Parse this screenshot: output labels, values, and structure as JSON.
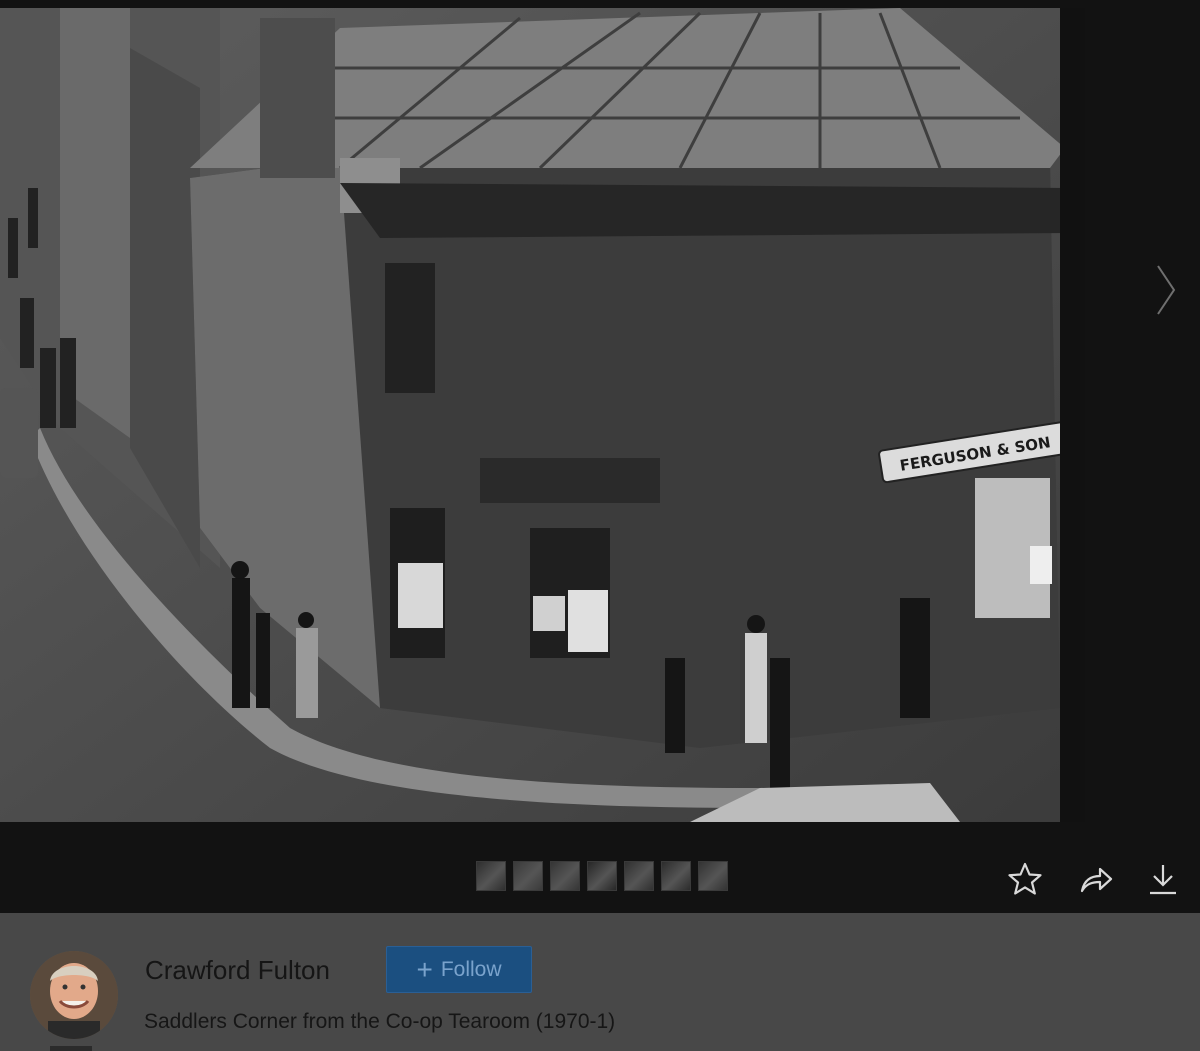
{
  "photo": {
    "shop_sign": "FERGUSON & SON"
  },
  "author": {
    "name": "Crawford Fulton"
  },
  "follow": {
    "label": "Follow"
  },
  "caption": "Saddlers Corner from the Co-op Tearoom (1970-1)",
  "thumbnails": [
    {
      "tone": "#2e2e2e"
    },
    {
      "tone": "#3a3a3a"
    },
    {
      "tone": "#353535"
    },
    {
      "tone": "#272727"
    },
    {
      "tone": "#303030"
    },
    {
      "tone": "#2c2c2c"
    },
    {
      "tone": "#333333"
    }
  ],
  "icons": {
    "next": "chevron-right-icon",
    "favorite": "star-icon",
    "share": "share-arrow-icon",
    "download": "download-icon"
  },
  "colors": {
    "follow_bg": "#1b4f80",
    "info_bg": "#484848",
    "viewer_bg": "#121212"
  }
}
